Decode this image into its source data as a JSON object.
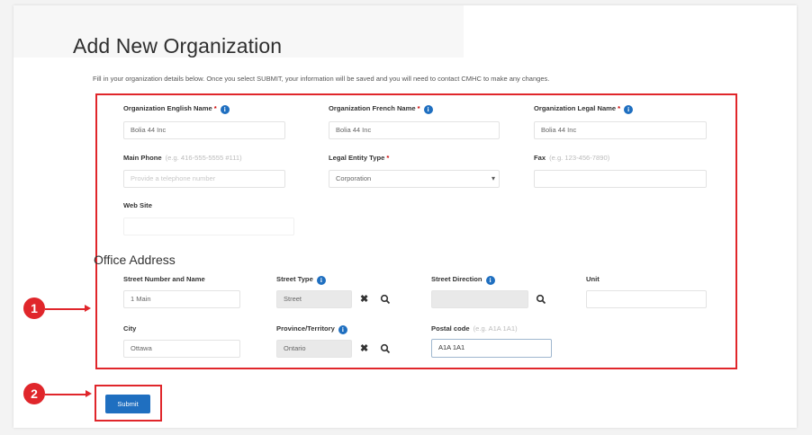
{
  "page": {
    "title": "Add New Organization",
    "intro": "Fill in your organization details below. Once you select SUBMIT, your information will be saved and you will need to contact CMHC to make any changes."
  },
  "org": {
    "english_name": {
      "label": "Organization English Name",
      "required": "*",
      "value": "Bolia 44 Inc"
    },
    "french_name": {
      "label": "Organization French Name",
      "required": "*",
      "value": "Bolia 44 Inc"
    },
    "legal_name": {
      "label": "Organization Legal Name",
      "required": "*",
      "value": "Bolia 44 Inc"
    },
    "main_phone": {
      "label": "Main Phone",
      "hint": "(e.g. 416-555-5555 #111)",
      "placeholder": "Provide a telephone number"
    },
    "legal_entity": {
      "label": "Legal Entity Type",
      "required": "*",
      "value": "Corporation"
    },
    "fax": {
      "label": "Fax",
      "hint": "(e.g. 123-456-7890)",
      "value": ""
    },
    "website": {
      "label": "Web Site",
      "value": ""
    }
  },
  "address": {
    "section_title": "Office Address",
    "street": {
      "label": "Street Number and Name",
      "value": "1 Main"
    },
    "street_type": {
      "label": "Street Type",
      "value": "Street"
    },
    "street_direction": {
      "label": "Street Direction",
      "value": ""
    },
    "unit": {
      "label": "Unit",
      "value": ""
    },
    "city": {
      "label": "City",
      "value": "Ottawa"
    },
    "province": {
      "label": "Province/Territory",
      "value": "Ontario"
    },
    "postal": {
      "label": "Postal code",
      "hint": "(e.g. A1A 1A1)",
      "value": "A1A 1A1"
    }
  },
  "actions": {
    "submit_label": "Submit"
  },
  "callouts": {
    "one": "1",
    "two": "2"
  },
  "icons": {
    "info": "info-icon",
    "clear": "close-icon",
    "search": "search-icon",
    "caret": "chevron-down-icon"
  },
  "colors": {
    "accent": "#1f6fc0",
    "highlight": "#e0262b"
  }
}
